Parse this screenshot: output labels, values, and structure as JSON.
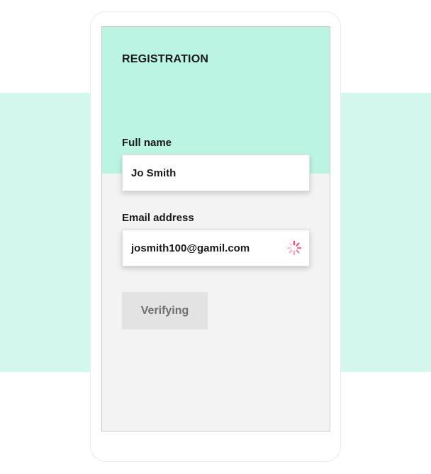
{
  "form": {
    "title": "REGISTRATION",
    "full_name": {
      "label": "Full name",
      "value": "Jo Smith"
    },
    "email": {
      "label": "Email address",
      "value": "josmith100@gamil.com",
      "status_icon": "loading-spinner-icon"
    },
    "submit_button": {
      "label": "Verifying",
      "state": "disabled"
    }
  },
  "colors": {
    "background_band": "#d3f7ec",
    "header": "#bcf4e4",
    "screen": "#f3f3f3",
    "spinner": "#e8497a",
    "button_bg": "#e3e3e3",
    "button_text": "#6f6f6f"
  }
}
